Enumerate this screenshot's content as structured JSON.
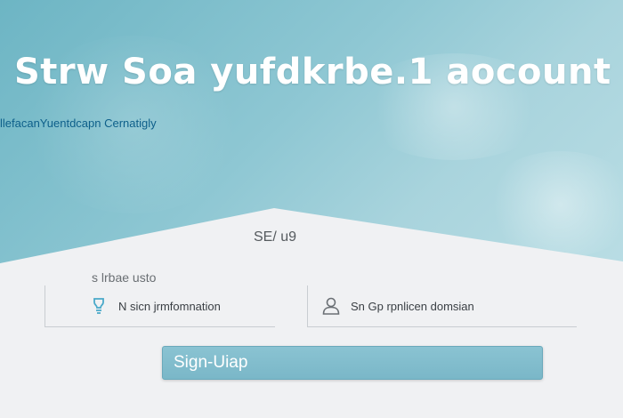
{
  "hero": {
    "title": "Strw Soa yufdkrbe.1 aocount",
    "subtitle": "llefacanYuentdcapn Cernatigly"
  },
  "form": {
    "heading": "SE/ u9",
    "section_label": "s  lrbae usto",
    "fields": [
      {
        "icon": "bulb-icon",
        "text": "N sicn jrmfomnation"
      },
      {
        "icon": "user-icon",
        "text": "Sn Gp rpnlicen domsian"
      }
    ],
    "signup_label": "Sign-Uiap"
  },
  "colors": {
    "hero_start": "#6db5c4",
    "hero_end": "#b9dde4",
    "button": "#7ab7c8",
    "subtitle": "#0d5f8a"
  }
}
